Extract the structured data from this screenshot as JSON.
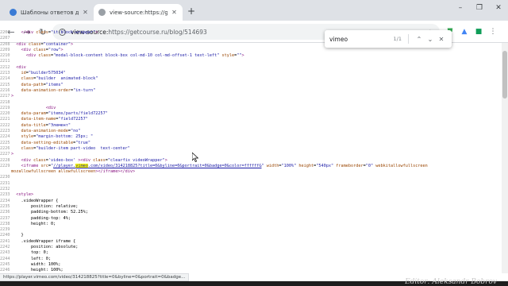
{
  "tabs": [
    {
      "title": "Шаблоны ответов для техподд...",
      "active": false
    },
    {
      "title": "view-source:https://getcourse.ru",
      "active": true
    }
  ],
  "new_tab_label": "+",
  "window_controls": [
    "–",
    "❐",
    "✕"
  ],
  "toolbar": {
    "back": "←",
    "forward": "→",
    "reload": "↻",
    "url_scheme": "view-source:",
    "url_rest": "https://getcourse.ru/blog/514693"
  },
  "find_bar": {
    "query": "vimeo",
    "count": "1/1",
    "prev": "⌃",
    "next": "⌄",
    "close": "✕"
  },
  "source_lines": [
    {
      "n": "2206",
      "parts": [
        [
          "t",
          "    "
        ],
        [
          "c",
          "</"
        ],
        [
          "c",
          "div"
        ],
        [
          "t",
          " "
        ],
        [
          "a",
          "class"
        ],
        [
          "t",
          "="
        ],
        [
          "v",
          "\"it-block-wrapper\""
        ],
        [
          "c",
          ">"
        ]
      ]
    },
    {
      "n": "2207",
      "parts": []
    },
    {
      "n": "2208",
      "parts": [
        [
          "t",
          "  "
        ],
        [
          "c",
          "<div"
        ],
        [
          "t",
          " "
        ],
        [
          "a",
          "class"
        ],
        [
          "t",
          "="
        ],
        [
          "v",
          "\"container\""
        ],
        [
          "c",
          ">"
        ]
      ]
    },
    {
      "n": "2209",
      "parts": [
        [
          "t",
          "    "
        ],
        [
          "c",
          "<div"
        ],
        [
          "t",
          " "
        ],
        [
          "a",
          "class"
        ],
        [
          "t",
          "="
        ],
        [
          "v",
          "\"row\""
        ],
        [
          "c",
          ">"
        ]
      ]
    },
    {
      "n": "2210",
      "parts": [
        [
          "t",
          "      "
        ],
        [
          "c",
          "<div"
        ],
        [
          "t",
          " "
        ],
        [
          "a",
          "class"
        ],
        [
          "t",
          "="
        ],
        [
          "v",
          "\"modal-block-content block-box col-md-10 col-md-offset-1 text-left\""
        ],
        [
          "t",
          " "
        ],
        [
          "a",
          "style"
        ],
        [
          "t",
          "="
        ],
        [
          "v",
          "\"\""
        ],
        [
          "c",
          ">"
        ]
      ]
    },
    {
      "n": "2211",
      "parts": []
    },
    {
      "n": "2212",
      "parts": [
        [
          "t",
          "  "
        ],
        [
          "c",
          "<div"
        ]
      ]
    },
    {
      "n": "2213",
      "parts": [
        [
          "t",
          "    "
        ],
        [
          "a",
          "id"
        ],
        [
          "t",
          "="
        ],
        [
          "v",
          "\"builder575034\""
        ]
      ]
    },
    {
      "n": "2214",
      "parts": [
        [
          "t",
          "    "
        ],
        [
          "a",
          "class"
        ],
        [
          "t",
          "="
        ],
        [
          "v",
          "\"builder  animated-block\""
        ]
      ]
    },
    {
      "n": "2215",
      "parts": [
        [
          "t",
          "    "
        ],
        [
          "a",
          "data-path"
        ],
        [
          "t",
          "="
        ],
        [
          "v",
          "\"items\""
        ]
      ]
    },
    {
      "n": "2216",
      "parts": [
        [
          "t",
          "    "
        ],
        [
          "a",
          "data-animation-order"
        ],
        [
          "t",
          "="
        ],
        [
          "v",
          "\"in-turn\""
        ]
      ]
    },
    {
      "n": "2217",
      "parts": [
        [
          "c",
          ">"
        ]
      ]
    },
    {
      "n": "2218",
      "parts": []
    },
    {
      "n": "2219",
      "parts": [
        [
          "t",
          "              "
        ],
        [
          "c",
          "<div"
        ]
      ]
    },
    {
      "n": "2220",
      "parts": [
        [
          "t",
          "    "
        ],
        [
          "a",
          "data-param"
        ],
        [
          "t",
          "="
        ],
        [
          "v",
          "\"items/parts/field72257\""
        ]
      ]
    },
    {
      "n": "2221",
      "parts": [
        [
          "t",
          "    "
        ],
        [
          "a",
          "data-item-name"
        ],
        [
          "t",
          "="
        ],
        [
          "v",
          "\"field72257\""
        ]
      ]
    },
    {
      "n": "2222",
      "parts": [
        [
          "t",
          "    "
        ],
        [
          "a",
          "data-title"
        ],
        [
          "t",
          "="
        ],
        [
          "v",
          "\"Элемент\""
        ]
      ]
    },
    {
      "n": "2223",
      "parts": [
        [
          "t",
          "    "
        ],
        [
          "a",
          "data-animation-mode"
        ],
        [
          "t",
          "="
        ],
        [
          "v",
          "\"no\""
        ]
      ]
    },
    {
      "n": "2224",
      "parts": [
        [
          "t",
          "    "
        ],
        [
          "a",
          "style"
        ],
        [
          "t",
          "="
        ],
        [
          "v",
          "\"margin-bottom: 25px; \""
        ]
      ]
    },
    {
      "n": "2225",
      "parts": [
        [
          "t",
          "    "
        ],
        [
          "a",
          "data-setting-editable"
        ],
        [
          "t",
          "="
        ],
        [
          "v",
          "\"true\""
        ]
      ]
    },
    {
      "n": "2226",
      "parts": [
        [
          "t",
          "    "
        ],
        [
          "a",
          "class"
        ],
        [
          "t",
          "="
        ],
        [
          "v",
          "\"builder-item part-video  text-center\""
        ]
      ]
    },
    {
      "n": "2227",
      "parts": [
        [
          "c",
          ">"
        ]
      ]
    },
    {
      "n": "2228",
      "parts": [
        [
          "t",
          "    "
        ],
        [
          "c",
          "<div"
        ],
        [
          "t",
          " "
        ],
        [
          "a",
          "class"
        ],
        [
          "t",
          "="
        ],
        [
          "v",
          "'video-box'"
        ],
        [
          "t",
          " "
        ],
        [
          "c",
          "><div"
        ],
        [
          "t",
          " "
        ],
        [
          "a",
          "class"
        ],
        [
          "t",
          "="
        ],
        [
          "v",
          "\"clearfix videoWrapper\""
        ],
        [
          "c",
          ">"
        ]
      ]
    },
    {
      "n": "2229",
      "parts": [
        [
          "t",
          "    "
        ],
        [
          "c",
          "<iframe"
        ],
        [
          "t",
          " "
        ],
        [
          "a",
          "src"
        ],
        [
          "t",
          "="
        ],
        [
          "v",
          "\""
        ],
        [
          "l",
          "//player."
        ],
        [
          "h",
          "vimeo"
        ],
        [
          "l",
          ".com/video/314218825?title=0&byline=0&portrait=0&badge=0&color=ffffff&"
        ],
        [
          "v",
          "\""
        ],
        [
          "t",
          " "
        ],
        [
          "a",
          "width"
        ],
        [
          "t",
          "="
        ],
        [
          "v",
          "\"100%\""
        ],
        [
          "t",
          " "
        ],
        [
          "a",
          "height"
        ],
        [
          "t",
          "="
        ],
        [
          "v",
          "\"540px\""
        ],
        [
          "t",
          " "
        ],
        [
          "a",
          "frameborder"
        ],
        [
          "t",
          "="
        ],
        [
          "v",
          "\"0\""
        ],
        [
          "t",
          " "
        ],
        [
          "a",
          "webkitallowfullscreen"
        ]
      ]
    },
    {
      "n": "",
      "parts": [
        [
          "a",
          "mozallowfullscreen"
        ],
        [
          "t",
          " "
        ],
        [
          "a",
          "allowfullscreen"
        ],
        [
          "c",
          "></iframe></div>"
        ]
      ]
    },
    {
      "n": "2230",
      "parts": []
    },
    {
      "n": "2231",
      "parts": []
    },
    {
      "n": "2232",
      "parts": []
    },
    {
      "n": "2233",
      "parts": [
        [
          "t",
          "  "
        ],
        [
          "c",
          "<style>"
        ]
      ]
    },
    {
      "n": "2234",
      "parts": [
        [
          "t",
          "    "
        ],
        [
          "x",
          ".videoWrapper {"
        ]
      ]
    },
    {
      "n": "2235",
      "parts": [
        [
          "t",
          "        "
        ],
        [
          "x",
          "position: relative;"
        ]
      ]
    },
    {
      "n": "2236",
      "parts": [
        [
          "t",
          "        "
        ],
        [
          "x",
          "padding-bottom: 52.25%;"
        ]
      ]
    },
    {
      "n": "2237",
      "parts": [
        [
          "t",
          "        "
        ],
        [
          "x",
          "padding-top: 4%;"
        ]
      ]
    },
    {
      "n": "2238",
      "parts": [
        [
          "t",
          "        "
        ],
        [
          "x",
          "height: 0;"
        ]
      ]
    },
    {
      "n": "2239",
      "parts": []
    },
    {
      "n": "2240",
      "parts": [
        [
          "t",
          "    "
        ],
        [
          "x",
          "}"
        ]
      ]
    },
    {
      "n": "2241",
      "parts": [
        [
          "t",
          "    "
        ],
        [
          "x",
          ".videoWrapper iframe {"
        ]
      ]
    },
    {
      "n": "2242",
      "parts": [
        [
          "t",
          "        "
        ],
        [
          "x",
          "position: absolute;"
        ]
      ]
    },
    {
      "n": "2243",
      "parts": [
        [
          "t",
          "        "
        ],
        [
          "x",
          "top: 0;"
        ]
      ]
    },
    {
      "n": "2244",
      "parts": [
        [
          "t",
          "        "
        ],
        [
          "x",
          "left: 0;"
        ]
      ]
    },
    {
      "n": "2245",
      "parts": [
        [
          "t",
          "        "
        ],
        [
          "x",
          "width: 100%;"
        ]
      ]
    },
    {
      "n": "2246",
      "parts": [
        [
          "t",
          "        "
        ],
        [
          "x",
          "height: 100%;"
        ]
      ]
    },
    {
      "n": "2247",
      "parts": [
        [
          "t",
          "    "
        ],
        [
          "x",
          "}"
        ]
      ]
    },
    {
      "n": "2248",
      "parts": [
        [
          "c",
          "</style></div></div>"
        ],
        [
          "t",
          "    "
        ],
        [
          "c",
          "</div>"
        ]
      ]
    }
  ],
  "status_url": "https://player.vimeo.com/video/314218825?title=0&byline=0&portrait=0&badge...",
  "watermark": "Editor: Aleksandr Bobrov",
  "colors": {
    "tag": "#881280",
    "attr": "#994500",
    "value": "#1a1aa6",
    "highlight": "#ffff00"
  }
}
